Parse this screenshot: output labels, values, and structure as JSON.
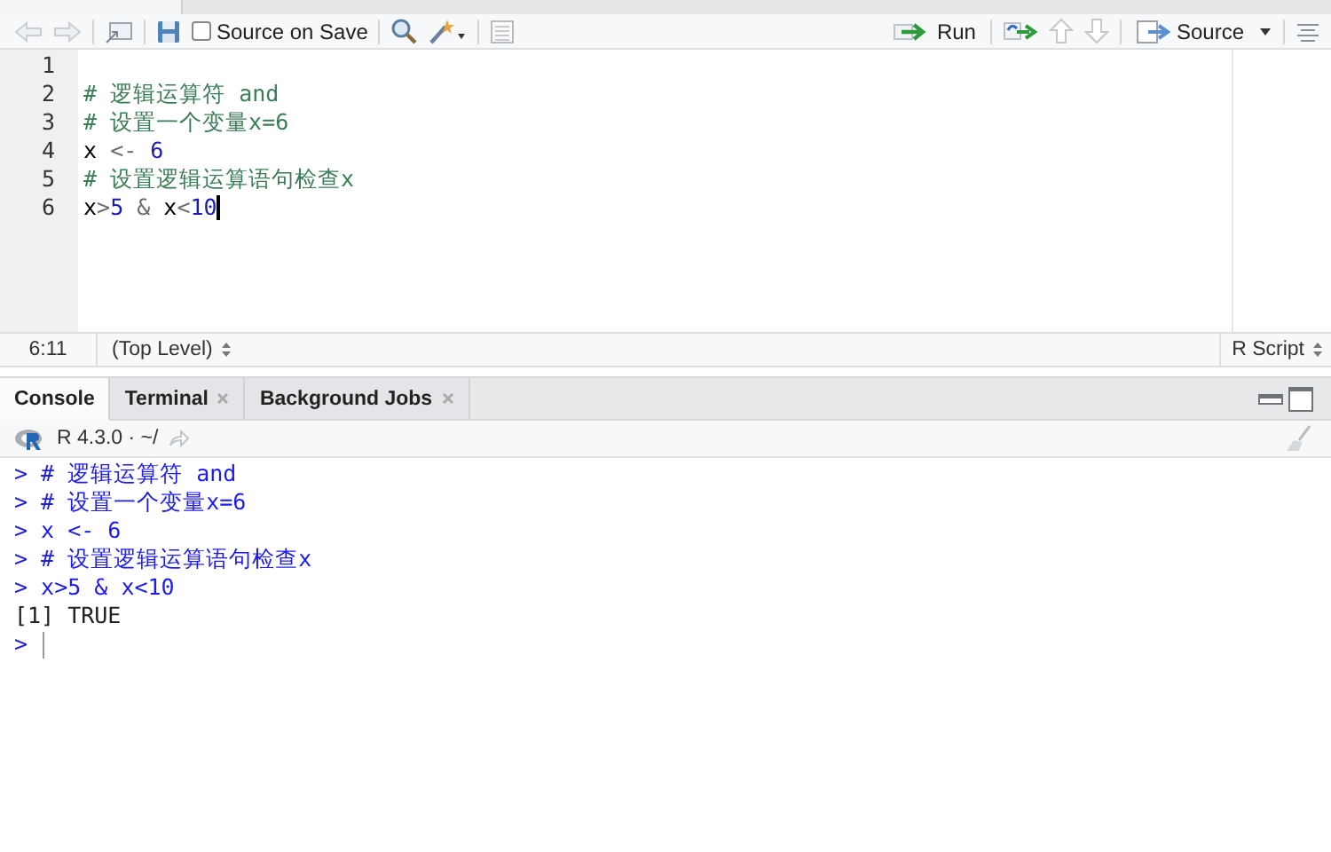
{
  "editor_toolbar": {
    "source_on_save": {
      "label": "Source on Save",
      "checked": false
    },
    "run_label": "Run",
    "source_label": "Source"
  },
  "editor": {
    "lines": [
      {
        "number": "1",
        "cursor": false
      },
      {
        "number": "2",
        "cursor": false,
        "tokens": [
          {
            "text": "# 逻辑运算符 and",
            "kind": "comment"
          }
        ]
      },
      {
        "number": "3",
        "cursor": false,
        "tokens": [
          {
            "text": "# 设置一个变量x=6",
            "kind": "comment"
          }
        ]
      },
      {
        "number": "4",
        "cursor": false,
        "tokens": [
          {
            "text": "x ",
            "kind": "plain"
          },
          {
            "text": "<- ",
            "kind": "op"
          },
          {
            "text": "6",
            "kind": "number"
          }
        ]
      },
      {
        "number": "5",
        "cursor": false,
        "tokens": [
          {
            "text": "# 设置逻辑运算语句检查x",
            "kind": "comment"
          }
        ]
      },
      {
        "number": "6",
        "cursor": true,
        "tokens": [
          {
            "text": "x",
            "kind": "plain"
          },
          {
            "text": ">",
            "kind": "op"
          },
          {
            "text": "5",
            "kind": "number"
          },
          {
            "text": " & ",
            "kind": "op"
          },
          {
            "text": "x",
            "kind": "plain"
          },
          {
            "text": "<",
            "kind": "op"
          },
          {
            "text": "10",
            "kind": "number"
          }
        ]
      }
    ]
  },
  "status_bar": {
    "position": "6:11",
    "scope": "(Top Level)",
    "file_type": "R Script"
  },
  "console_tabs": [
    {
      "label": "Console",
      "selected": true,
      "closable": false
    },
    {
      "label": "Terminal",
      "selected": false,
      "closable": true
    },
    {
      "label": "Background Jobs",
      "selected": false,
      "closable": true
    }
  ],
  "console_bar": {
    "session": "R 4.3.0 · ~/"
  },
  "console": {
    "lines": [
      {
        "kind": "input",
        "prompt": ">",
        "text": "# 逻辑运算符 and"
      },
      {
        "kind": "input",
        "prompt": ">",
        "text": "# 设置一个变量x=6"
      },
      {
        "kind": "input",
        "prompt": ">",
        "text": "x <- 6"
      },
      {
        "kind": "input",
        "prompt": ">",
        "text": "# 设置逻辑运算语句检查x"
      },
      {
        "kind": "input",
        "prompt": ">",
        "text": "x>5 & x<10"
      },
      {
        "kind": "output",
        "text": "[1] TRUE"
      },
      {
        "kind": "prompt",
        "prompt": ">"
      }
    ]
  }
}
